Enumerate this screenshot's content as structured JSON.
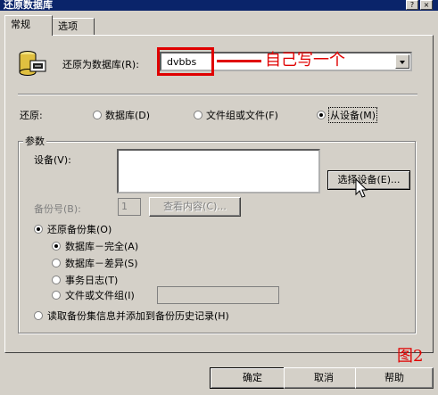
{
  "window": {
    "title": "还原数据库",
    "help_glyph": "?",
    "close_glyph": "×"
  },
  "tabs": [
    {
      "label": "常规",
      "active": true
    },
    {
      "label": "选项",
      "active": false
    }
  ],
  "restore_as": {
    "label": "还原为数据库(R):",
    "value": "dvbbs",
    "annotation": "自己写一个",
    "icon": "database-icon"
  },
  "restore": {
    "label": "还原:",
    "options": [
      "数据库(D)",
      "文件组或文件(F)",
      "从设备(M)"
    ],
    "selected": "从设备(M)"
  },
  "params": {
    "title": "参数",
    "device_label": "设备(V):",
    "select_device_button": "选择设备(E)...",
    "backup_no_label": "备份号(B):",
    "backup_no_value": "1",
    "view_contents_button": "查看内容(C)...",
    "restore_set_label": "还原备份集(O)",
    "set_options": [
      "数据库－完全(A)",
      "数据库－差异(S)",
      "事务日志(T)",
      "文件或文件组(I)"
    ],
    "set_selected": "数据库－完全(A)",
    "read_info_label": "读取备份集信息并添加到备份历史记录(H)"
  },
  "footer": {
    "ok": "确定",
    "cancel": "取消",
    "help": "帮助",
    "figure_label": "图2"
  },
  "colors": {
    "annotation": "#e00000",
    "titlebar": "#0a246a",
    "face": "#d4d0c8"
  }
}
